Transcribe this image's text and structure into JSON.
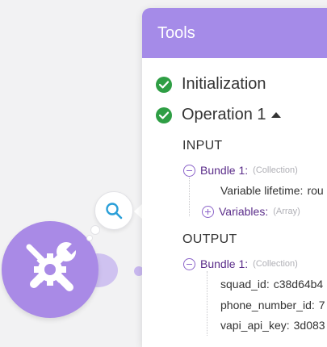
{
  "panel": {
    "title": "Tools",
    "operations": [
      {
        "label": "Initialization",
        "status": "success"
      },
      {
        "label": "Operation 1",
        "status": "success",
        "expanded": true
      }
    ]
  },
  "input": {
    "title": "INPUT",
    "bundle_label": "Bundle 1:",
    "bundle_type": "(Collection)",
    "items": [
      {
        "key": "Variable lifetime:",
        "value": "rou"
      },
      {
        "key": "Variables:",
        "type": "(Array)"
      }
    ]
  },
  "output": {
    "title": "OUTPUT",
    "bundle_label": "Bundle 1:",
    "bundle_type": "(Collection)",
    "items": [
      {
        "key": "squad_id:",
        "value": "c38d64b4"
      },
      {
        "key": "phone_number_id:",
        "value": "7"
      },
      {
        "key": "vapi_api_key:",
        "value": "3d083"
      }
    ]
  },
  "colors": {
    "header_bg": "#a58be8",
    "module_bg": "#a98ae6",
    "success": "#2e9e44",
    "tree_icon": "#8b63c9"
  },
  "icons": {
    "module": "tools-wrench-screwdriver-gear-icon",
    "inspect": "search-icon",
    "status": "check-circle-icon",
    "toggle_open": "minus-circle-icon",
    "toggle_closed": "plus-circle-icon"
  }
}
